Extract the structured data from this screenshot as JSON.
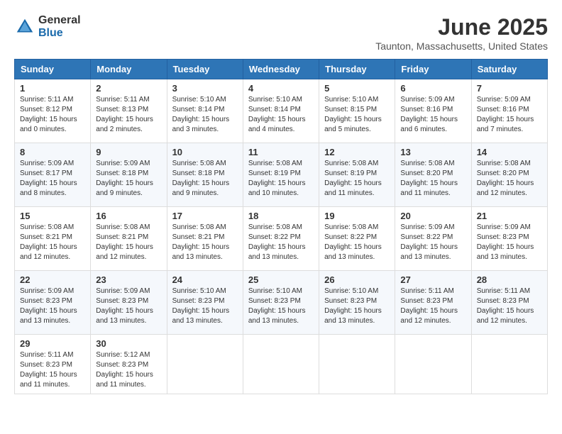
{
  "header": {
    "logo_general": "General",
    "logo_blue": "Blue",
    "month": "June 2025",
    "location": "Taunton, Massachusetts, United States"
  },
  "weekdays": [
    "Sunday",
    "Monday",
    "Tuesday",
    "Wednesday",
    "Thursday",
    "Friday",
    "Saturday"
  ],
  "weeks": [
    [
      {
        "day": "1",
        "sunrise": "5:11 AM",
        "sunset": "8:12 PM",
        "daylight": "15 hours and 0 minutes."
      },
      {
        "day": "2",
        "sunrise": "5:11 AM",
        "sunset": "8:13 PM",
        "daylight": "15 hours and 2 minutes."
      },
      {
        "day": "3",
        "sunrise": "5:10 AM",
        "sunset": "8:14 PM",
        "daylight": "15 hours and 3 minutes."
      },
      {
        "day": "4",
        "sunrise": "5:10 AM",
        "sunset": "8:14 PM",
        "daylight": "15 hours and 4 minutes."
      },
      {
        "day": "5",
        "sunrise": "5:10 AM",
        "sunset": "8:15 PM",
        "daylight": "15 hours and 5 minutes."
      },
      {
        "day": "6",
        "sunrise": "5:09 AM",
        "sunset": "8:16 PM",
        "daylight": "15 hours and 6 minutes."
      },
      {
        "day": "7",
        "sunrise": "5:09 AM",
        "sunset": "8:16 PM",
        "daylight": "15 hours and 7 minutes."
      }
    ],
    [
      {
        "day": "8",
        "sunrise": "5:09 AM",
        "sunset": "8:17 PM",
        "daylight": "15 hours and 8 minutes."
      },
      {
        "day": "9",
        "sunrise": "5:09 AM",
        "sunset": "8:18 PM",
        "daylight": "15 hours and 9 minutes."
      },
      {
        "day": "10",
        "sunrise": "5:08 AM",
        "sunset": "8:18 PM",
        "daylight": "15 hours and 9 minutes."
      },
      {
        "day": "11",
        "sunrise": "5:08 AM",
        "sunset": "8:19 PM",
        "daylight": "15 hours and 10 minutes."
      },
      {
        "day": "12",
        "sunrise": "5:08 AM",
        "sunset": "8:19 PM",
        "daylight": "15 hours and 11 minutes."
      },
      {
        "day": "13",
        "sunrise": "5:08 AM",
        "sunset": "8:20 PM",
        "daylight": "15 hours and 11 minutes."
      },
      {
        "day": "14",
        "sunrise": "5:08 AM",
        "sunset": "8:20 PM",
        "daylight": "15 hours and 12 minutes."
      }
    ],
    [
      {
        "day": "15",
        "sunrise": "5:08 AM",
        "sunset": "8:21 PM",
        "daylight": "15 hours and 12 minutes."
      },
      {
        "day": "16",
        "sunrise": "5:08 AM",
        "sunset": "8:21 PM",
        "daylight": "15 hours and 12 minutes."
      },
      {
        "day": "17",
        "sunrise": "5:08 AM",
        "sunset": "8:21 PM",
        "daylight": "15 hours and 13 minutes."
      },
      {
        "day": "18",
        "sunrise": "5:08 AM",
        "sunset": "8:22 PM",
        "daylight": "15 hours and 13 minutes."
      },
      {
        "day": "19",
        "sunrise": "5:08 AM",
        "sunset": "8:22 PM",
        "daylight": "15 hours and 13 minutes."
      },
      {
        "day": "20",
        "sunrise": "5:09 AM",
        "sunset": "8:22 PM",
        "daylight": "15 hours and 13 minutes."
      },
      {
        "day": "21",
        "sunrise": "5:09 AM",
        "sunset": "8:23 PM",
        "daylight": "15 hours and 13 minutes."
      }
    ],
    [
      {
        "day": "22",
        "sunrise": "5:09 AM",
        "sunset": "8:23 PM",
        "daylight": "15 hours and 13 minutes."
      },
      {
        "day": "23",
        "sunrise": "5:09 AM",
        "sunset": "8:23 PM",
        "daylight": "15 hours and 13 minutes."
      },
      {
        "day": "24",
        "sunrise": "5:10 AM",
        "sunset": "8:23 PM",
        "daylight": "15 hours and 13 minutes."
      },
      {
        "day": "25",
        "sunrise": "5:10 AM",
        "sunset": "8:23 PM",
        "daylight": "15 hours and 13 minutes."
      },
      {
        "day": "26",
        "sunrise": "5:10 AM",
        "sunset": "8:23 PM",
        "daylight": "15 hours and 13 minutes."
      },
      {
        "day": "27",
        "sunrise": "5:11 AM",
        "sunset": "8:23 PM",
        "daylight": "15 hours and 12 minutes."
      },
      {
        "day": "28",
        "sunrise": "5:11 AM",
        "sunset": "8:23 PM",
        "daylight": "15 hours and 12 minutes."
      }
    ],
    [
      {
        "day": "29",
        "sunrise": "5:11 AM",
        "sunset": "8:23 PM",
        "daylight": "15 hours and 11 minutes."
      },
      {
        "day": "30",
        "sunrise": "5:12 AM",
        "sunset": "8:23 PM",
        "daylight": "15 hours and 11 minutes."
      },
      null,
      null,
      null,
      null,
      null
    ]
  ]
}
